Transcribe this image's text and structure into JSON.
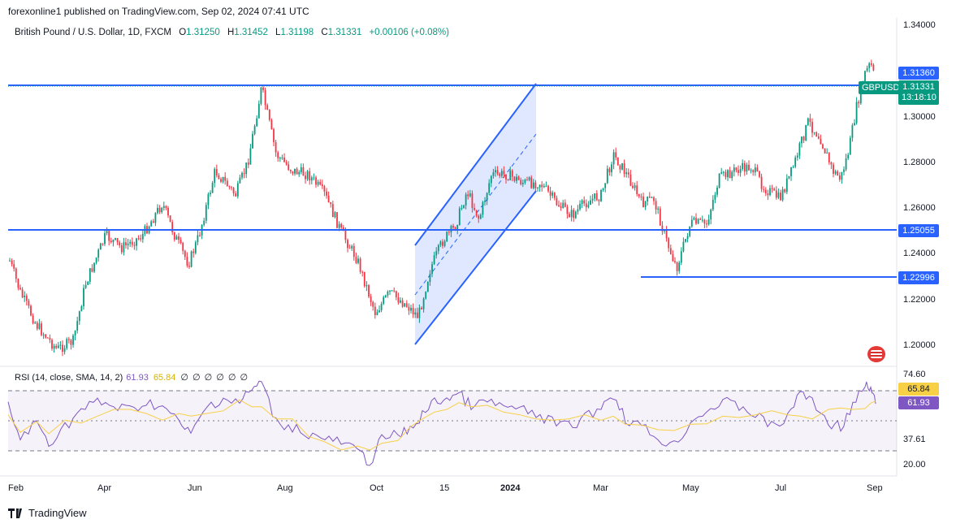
{
  "header": {
    "published": "forexonline1 published on TradingView.com, Sep 02, 2024 07:41 UTC"
  },
  "legend": {
    "symbol_desc": "British Pound / U.S. Dollar, 1D, FXCM",
    "o_label": "O",
    "o_val": "1.31250",
    "h_label": "H",
    "h_val": "1.31452",
    "l_label": "L",
    "l_val": "1.31198",
    "c_label": "C",
    "c_val": "1.31331",
    "change": "+0.00106 (+0.08%)"
  },
  "rsi_legend": {
    "title": "RSI (14, close, SMA, 14, 2)",
    "rsi_value": "61.93",
    "sma_value": "65.84",
    "na": "∅ ∅ ∅ ∅ ∅ ∅"
  },
  "price_axis": [
    "1.34000",
    "1.30000",
    "1.28000",
    "1.26000",
    "1.24000",
    "1.22000",
    "1.20000"
  ],
  "price_tags": {
    "level_high": "1.31360",
    "symbol": "GBPUSD",
    "last_price": "1.31331",
    "countdown": "13:18:10",
    "level_mid": "1.25055",
    "level_low": "1.22996"
  },
  "rsi_axis": {
    "top": "74.60",
    "sma": "65.84",
    "rsi": "61.93",
    "low": "37.61",
    "bottom": "20.00"
  },
  "time_axis": [
    "Feb",
    "Apr",
    "Jun",
    "Aug",
    "Oct",
    "15",
    "2024",
    "Mar",
    "May",
    "Jul",
    "Sep"
  ],
  "footer": {
    "brand": "TradingView"
  },
  "colors": {
    "up": "#089981",
    "down": "#f23645",
    "line": "#2962ff",
    "rsi": "#7e57c2",
    "sma": "#f7d046"
  }
}
